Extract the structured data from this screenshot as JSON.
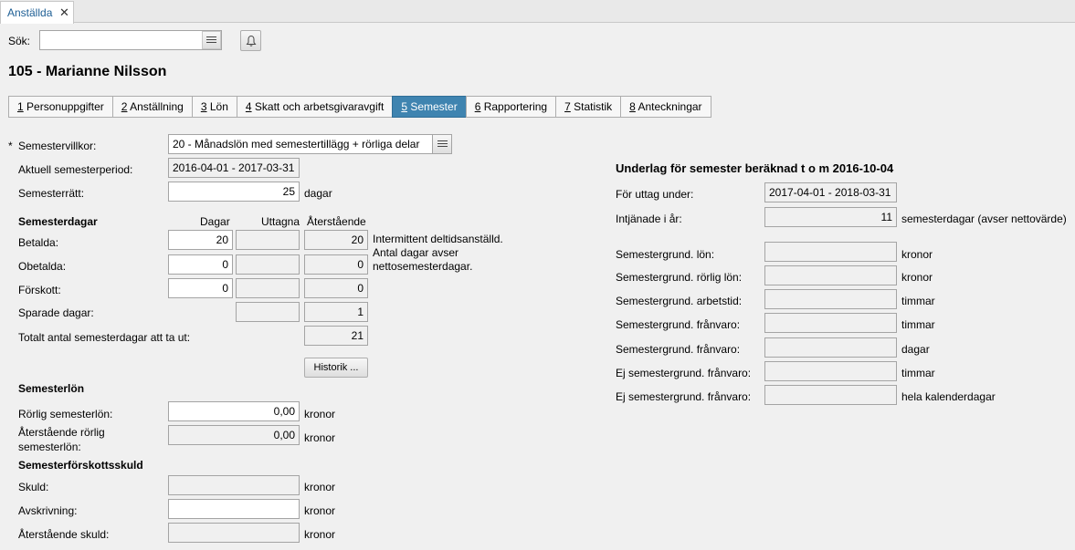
{
  "doc_tab": {
    "label": "Anställda",
    "close": "✕"
  },
  "search": {
    "label": "Sök:",
    "value": ""
  },
  "employee_title": "105 - Marianne Nilsson",
  "tabs": [
    {
      "num": "1",
      "label": " Personuppgifter"
    },
    {
      "num": "2",
      "label": " Anställning"
    },
    {
      "num": "3",
      "label": " Lön"
    },
    {
      "num": "4",
      "label": " Skatt och arbetsgivaravgift"
    },
    {
      "num": "5",
      "label": " Semester"
    },
    {
      "num": "6",
      "label": " Rapportering"
    },
    {
      "num": "7",
      "label": " Statistik"
    },
    {
      "num": "8",
      "label": " Anteckningar"
    }
  ],
  "active_tab": "5",
  "left": {
    "required_mark": "*",
    "villkor_label": "Semestervillkor:",
    "villkor_value": "20 - Månadslön med semestertillägg + rörliga delar",
    "period_label": "Aktuell semesterperiod:",
    "period_value": "2016-04-01 - 2017-03-31",
    "ratt_label": "Semesterrätt:",
    "ratt_value": "25",
    "ratt_unit": "dagar",
    "dagar_heading": "Semesterdagar",
    "col_dagar": "Dagar",
    "col_uttagna": "Uttagna",
    "col_aterstaende": "Återstående",
    "betalda_label": "Betalda:",
    "betalda_dagar": "20",
    "betalda_uttagna": "",
    "betalda_ater": "20",
    "obetalda_label": "Obetalda:",
    "obetalda_dagar": "0",
    "obetalda_uttagna": "",
    "obetalda_ater": "0",
    "forskott_label": "Förskott:",
    "forskott_dagar": "0",
    "forskott_uttagna": "",
    "forskott_ater": "0",
    "sparade_label": "Sparade dagar:",
    "sparade_uttagna": "",
    "sparade_ater": "1",
    "totalt_label": "Totalt antal semesterdagar att ta ut:",
    "totalt_value": "21",
    "note_line1": "Intermittent deltidsanställd.",
    "note_line2": "Antal dagar avser",
    "note_line3": "nettosemesterdagar.",
    "historik_button": "Historik ...",
    "lon_heading": "Semesterlön",
    "rorlig_label": "Rörlig semesterlön:",
    "rorlig_value": "0,00",
    "rorlig_unit": "kronor",
    "ater_rorlig_label1": "Återstående rörlig",
    "ater_rorlig_label2": "semesterlön:",
    "ater_rorlig_value": "0,00",
    "ater_rorlig_unit": "kronor",
    "skuld_heading": "Semesterförskottsskuld",
    "skuld_label": "Skuld:",
    "skuld_value": "",
    "skuld_unit": "kronor",
    "avskrivning_label": "Avskrivning:",
    "avskrivning_value": "",
    "avskrivning_unit": "kronor",
    "ater_skuld_label": "Återstående skuld:",
    "ater_skuld_value": "",
    "ater_skuld_unit": "kronor"
  },
  "right": {
    "heading": "Underlag för semester beräknad t o m 2016-10-04",
    "uttag_label": "För uttag under:",
    "uttag_value": "2017-04-01 - 2018-03-31",
    "intjanade_label": "Intjänade i år:",
    "intjanade_value": "11",
    "intjanade_unit": "semesterdagar (avser nettovärde)",
    "rows": [
      {
        "label": "Semestergrund. lön:",
        "value": "",
        "unit": "kronor"
      },
      {
        "label": "Semestergrund. rörlig lön:",
        "value": "",
        "unit": "kronor"
      },
      {
        "label": "Semestergrund. arbetstid:",
        "value": "",
        "unit": "timmar"
      },
      {
        "label": "Semestergrund. frånvaro:",
        "value": "",
        "unit": "timmar"
      },
      {
        "label": "Semestergrund. frånvaro:",
        "value": "",
        "unit": "dagar"
      },
      {
        "label": "Ej semestergrund. frånvaro:",
        "value": "",
        "unit": "timmar"
      },
      {
        "label": "Ej semestergrund. frånvaro:",
        "value": "",
        "unit": "hela kalenderdagar"
      }
    ]
  }
}
